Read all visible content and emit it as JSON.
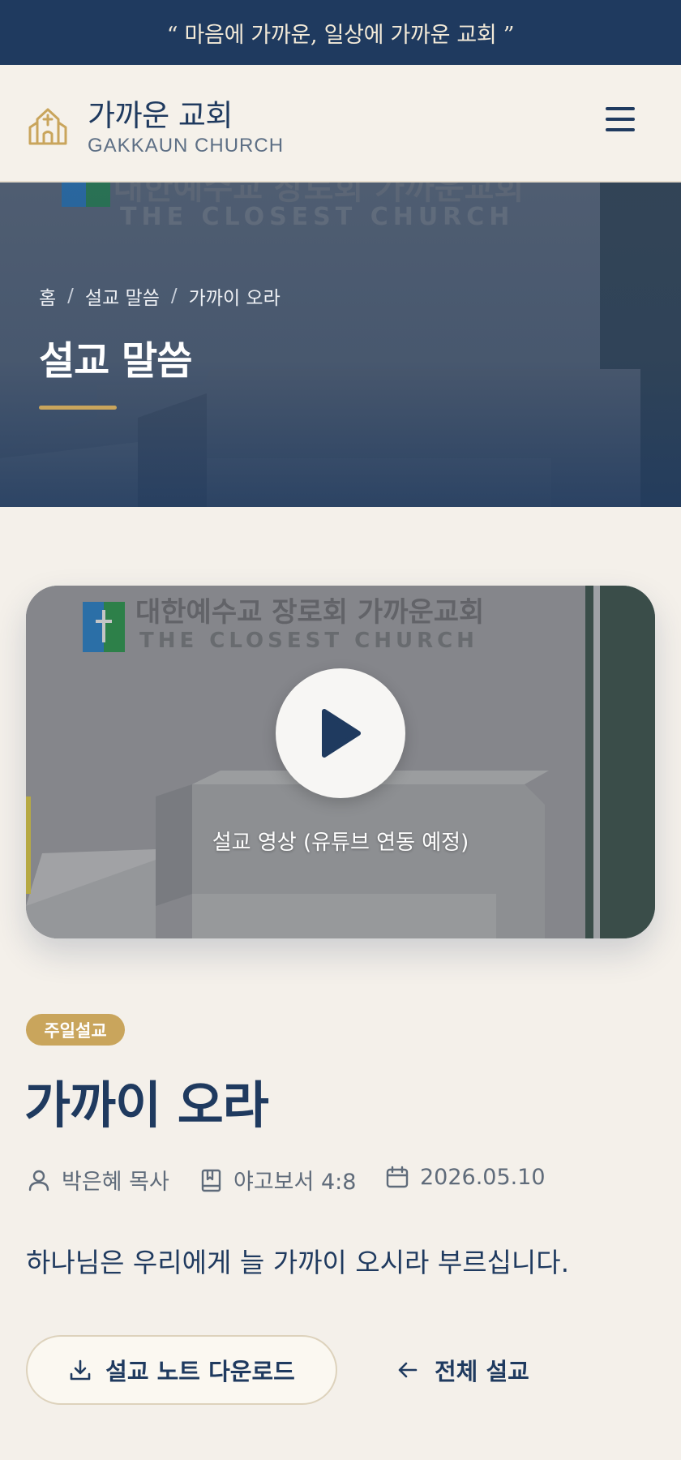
{
  "banner": {
    "tagline": "“ 마음에 가까운, 일상에 가까운 교회 ”"
  },
  "header": {
    "brand_name": "가까운 교회",
    "brand_sub": "GAKKAUN CHURCH",
    "logo_icon": "church-icon",
    "menu_icon": "hamburger-menu-icon"
  },
  "hero": {
    "breadcrumb": [
      "홈",
      "설교 말씀",
      "가까이 오라"
    ],
    "breadcrumb_sep": "/",
    "title": "설교 말씀",
    "sign_korean": "대한예수교 장로회 가까운교회",
    "sign_english": "THE CLOSEST CHURCH"
  },
  "video": {
    "caption": "설교 영상 (유튜브 연동 예정)",
    "play_icon": "play-icon"
  },
  "sermon": {
    "category": "주일설교",
    "title": "가까이 오라",
    "preacher": "박은혜 목사",
    "scripture": "야고보서 4:8",
    "date": "2026.05.10",
    "summary": "하나님은 우리에게 늘 가까이 오시라 부르십니다."
  },
  "actions": {
    "download_label": "설교 노트 다운로드",
    "back_label": "전체 설교"
  },
  "colors": {
    "navy": "#1f3a5f",
    "gold": "#c9a55c",
    "background": "#f4f0ea",
    "muted_text": "#5f6b7a"
  }
}
